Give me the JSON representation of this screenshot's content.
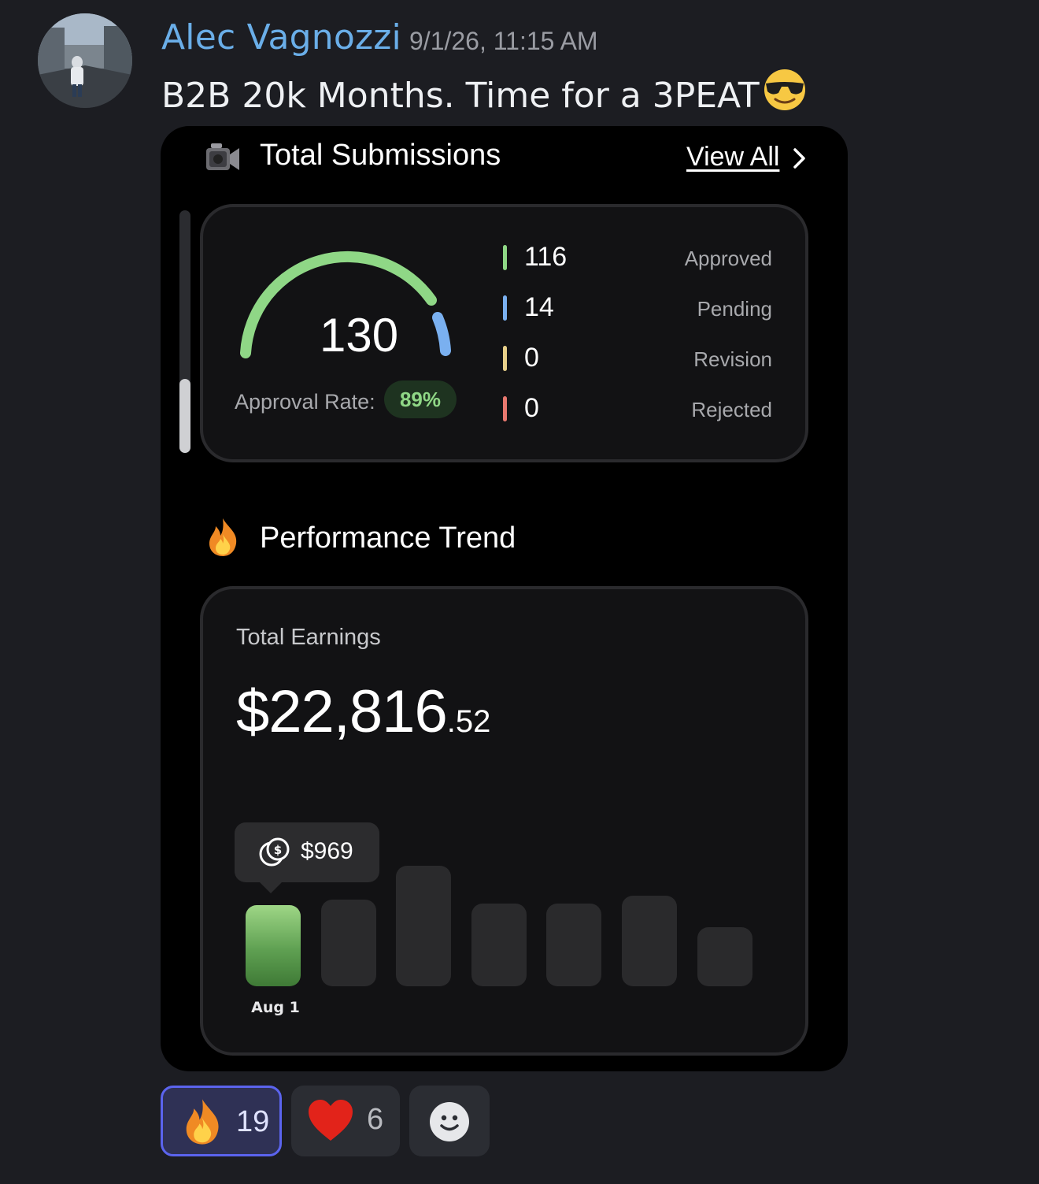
{
  "message": {
    "author": "Alec Vagnozzi",
    "timestamp": "9/1/26, 11:15 AM",
    "text": "B2B 20k Months. Time for a 3PEAT",
    "text_emoji": "sunglasses-face-icon"
  },
  "submissions": {
    "title": "Total Submissions",
    "title_icon": "video-camera-icon",
    "view_all_label": "View All",
    "total": "130",
    "approval_rate_label": "Approval Rate:",
    "approval_rate": "89%",
    "stats": [
      {
        "value": "116",
        "label": "Approved",
        "color": "#8fd786"
      },
      {
        "value": "14",
        "label": "Pending",
        "color": "#7ab0f0"
      },
      {
        "value": "0",
        "label": "Revision",
        "color": "#e8d08a"
      },
      {
        "value": "0",
        "label": "Rejected",
        "color": "#e8786f"
      }
    ]
  },
  "performance": {
    "title": "Performance Trend",
    "title_icon": "fire-icon",
    "earnings_label": "Total Earnings",
    "earnings_main": "$22,816",
    "earnings_cents": ".52",
    "tooltip_value": "$969",
    "tooltip_icon": "coins-dollar-icon",
    "active_bar_label": "Aug 1"
  },
  "chart_data": {
    "type": "bar",
    "categories": [
      "Aug 1",
      "",
      "",
      "",
      "",
      "",
      ""
    ],
    "values": [
      969,
      1035,
      1445,
      995,
      995,
      1085,
      705
    ],
    "highlight_index": 0,
    "accent_color": "#8fd786"
  },
  "reactions": [
    {
      "icon": "fire-icon",
      "count": "19",
      "active": true
    },
    {
      "icon": "heart-icon",
      "count": "6",
      "active": false
    },
    {
      "icon": "add-reaction-icon",
      "count": "",
      "active": false
    }
  ]
}
